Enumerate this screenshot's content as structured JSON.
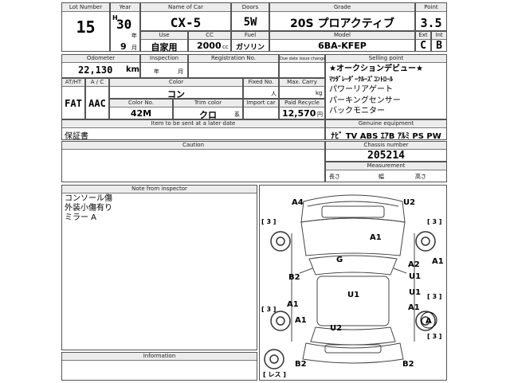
{
  "header_labels": {
    "lot": "Lot Number",
    "year": "Year",
    "name": "Name of Car",
    "doors": "Doors",
    "grade": "Grade",
    "point": "Point",
    "use": "Use",
    "cc": "CC",
    "fuel": "Fuel",
    "model": "Model",
    "ext": "Ext",
    "int": "Int",
    "odometer": "Odometer",
    "inspection": "Inspection",
    "registration": "Registration No.",
    "due_date": "Due date issue change",
    "selling_point": "Selling point",
    "at_ht": "AT/HT",
    "ac": "A / C",
    "color": "Color",
    "fixed_no": "Fixed No.",
    "max_carry": "Max. Carry",
    "color_no": "Color No.",
    "trim_color": "Trim color",
    "import_car": "Import car",
    "paid_recycle": "Paid Recycle",
    "items_sent": "Item to be sent at a later date",
    "genuine": "Genuine equipment",
    "caution": "Caution",
    "chassis": "Chassis number",
    "measurement": "Measurement",
    "note": "Note from inspector",
    "information": "Information"
  },
  "vehicle": {
    "lot": "15",
    "era": "H",
    "year": "30",
    "year_unit": "年",
    "month": "9",
    "month_unit": "月",
    "name": "CX-5",
    "doors": "5W",
    "grade": "20S プロアクティブ",
    "point": "3.5",
    "use": "自家用",
    "cc": "2000",
    "cc_unit": "cc",
    "fuel": "ガソリン",
    "model": "6BA-KFEP",
    "ext": "C",
    "int": "B",
    "odometer": "22,130",
    "odometer_unit": "km",
    "insp_year": "年",
    "insp_month": "月",
    "transmission": "FAT",
    "ac": "AAC",
    "color_name": "コン",
    "fixed_unit": "人",
    "carry_unit": "kg",
    "color_no": "42M",
    "trim_color": "クロ",
    "import_unit": "系",
    "recycle": "12,570",
    "recycle_unit": "円",
    "items_sent": "保証書",
    "genuine": "ﾅﾋﾞ TV ABS ｴｱB ｱﾙﾐ PS PW",
    "chassis": "205214",
    "meas_length": "長さ",
    "meas_width": "幅",
    "meas_height": "高さ"
  },
  "selling_points": [
    "★オークションデビュー★",
    "ﾏﾂﾀﾞﾚｰﾀﾞｰｸﾙｰｽﾞｺﾝﾄﾛｰﾙ",
    "パワーリアゲート",
    "パーキングセンサー",
    "バックモニター"
  ],
  "inspector_notes": [
    "コンソール傷",
    "外装小傷有り",
    "ミラー A"
  ],
  "damage_marks": {
    "front_left": "A4",
    "front_right": "U2",
    "bonnet": "A1",
    "roof": "G",
    "right_upper": "A2",
    "right_a1": "A1",
    "right_u1a": "U1",
    "right_u1b": "U1",
    "left_b2": "B2",
    "left_a1a": "A1",
    "left_a1b": "A1",
    "center_u1": "U1",
    "rear_u2": "U2",
    "rear_a1": "A1",
    "rear_circle": "A",
    "bottom_left": "B2",
    "bottom_right": "B2",
    "tire_tl": "[ 3 ]",
    "tire_tr": "[ 3 ]",
    "tire_ml": "[ 3 ]",
    "tire_mr": "[ 3 ]",
    "tire_bl": "[ 3 ]",
    "tire_br": "[ 3 ]",
    "spare": "[ レス ]"
  }
}
